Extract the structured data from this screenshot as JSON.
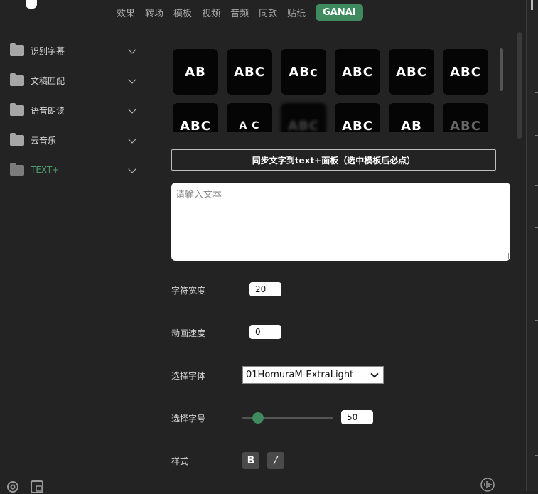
{
  "tabs": [
    "效果",
    "转场",
    "模板",
    "视频",
    "音频",
    "同款",
    "贴纸",
    "GANAI"
  ],
  "active_tab": "GANAI",
  "sidebar": {
    "items": [
      {
        "label": "识别字幕"
      },
      {
        "label": "文稿匹配"
      },
      {
        "label": "语音朗读"
      },
      {
        "label": "云音乐"
      },
      {
        "label": "TEXT+"
      }
    ]
  },
  "templates": {
    "row1": [
      "AB",
      "ABC",
      "ABc",
      "ABC",
      "ABC",
      "ABC"
    ],
    "row2": [
      "ABC",
      "A C",
      "ABC",
      "ABC",
      "AB",
      "ABC"
    ]
  },
  "sync_button": "同步文字到text+面板（选中模板后必点）",
  "text_input": {
    "placeholder": "请输入文本",
    "value": ""
  },
  "fields": {
    "char_width": {
      "label": "字符宽度",
      "value": "20"
    },
    "anim_speed": {
      "label": "动画速度",
      "value": "0"
    },
    "font": {
      "label": "选择字体",
      "value": "01HomuraM-ExtraLight"
    },
    "font_size": {
      "label": "选择字号",
      "value": "50",
      "slider_fraction": 0.17
    },
    "style": {
      "label": "样式",
      "bold": "B",
      "italic": "/"
    }
  },
  "colors": {
    "accent": "#3f8a5f",
    "background": "#232323"
  },
  "icons": [
    "settings-icon",
    "layout-icon",
    "audio-wave-icon",
    "folder-icon",
    "chevron-down-icon"
  ]
}
